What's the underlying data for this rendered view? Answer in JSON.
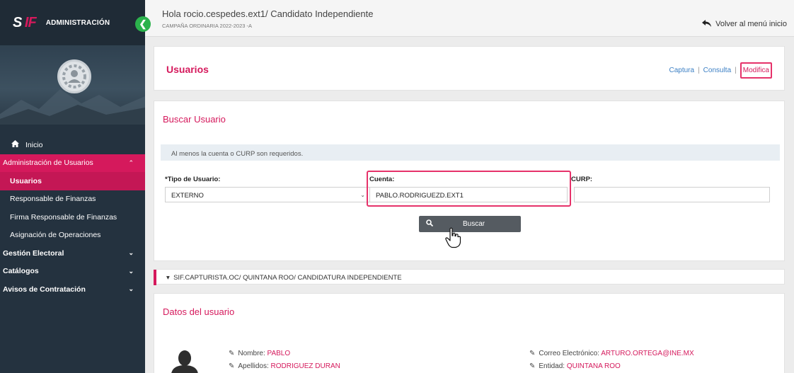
{
  "sidebar": {
    "brand_logo_left": "S",
    "brand_logo_right": "IF",
    "brand_title": "ADMINISTRACIÓN",
    "collapse_glyph": "❮",
    "items": [
      {
        "label": "Inicio"
      },
      {
        "label": "Administración de Usuarios"
      },
      {
        "label": "Usuarios"
      },
      {
        "label": "Responsable de Finanzas"
      },
      {
        "label": "Firma Responsable de Finanzas"
      },
      {
        "label": "Asignación de Operaciones"
      },
      {
        "label": "Gestión Electoral"
      },
      {
        "label": "Catálogos"
      },
      {
        "label": "Avisos de Contratación"
      }
    ]
  },
  "header": {
    "greeting": "Hola rocio.cespedes.ext1/ Candidato Independiente",
    "campaign": "CAMPAÑA ORDINARIA 2022-2023 -A",
    "back_label": "Volver al menú inicio"
  },
  "usuarios_card": {
    "title": "Usuarios",
    "links": {
      "captura": "Captura",
      "consulta": "Consulta",
      "modifica": "Modifica"
    }
  },
  "buscar_card": {
    "title": "Buscar Usuario",
    "hint": "Al menos la cuenta o CURP son requeridos.",
    "tipo_label": "*Tipo de Usuario:",
    "tipo_value": "EXTERNO",
    "cuenta_label": "Cuenta:",
    "cuenta_value": "PABLO.RODRIGUEZD.EXT1",
    "curp_label": "CURP:",
    "curp_value": "",
    "buscar_label": "Buscar"
  },
  "role_bar": {
    "text": "SIF.CAPTURISTA.OC/ QUINTANA ROO/ CANDIDATURA INDEPENDIENTE"
  },
  "datos_card": {
    "title": "Datos del usuario",
    "nombre_label": "Nombre:",
    "nombre_value": "PABLO",
    "apellidos_label": "Apellidos:",
    "apellidos_value": "RODRIGUEZ DURAN",
    "correo_label": "Correo Electrónico:",
    "correo_value": "ARTURO.ORTEGA@INE.MX",
    "entidad_label": "Entidad:",
    "entidad_value": "QUINTANA ROO"
  },
  "colors": {
    "accent": "#d5195c",
    "sidebar": "#24323f",
    "link": "#3b7fc4",
    "toggle": "#2bb24c"
  }
}
